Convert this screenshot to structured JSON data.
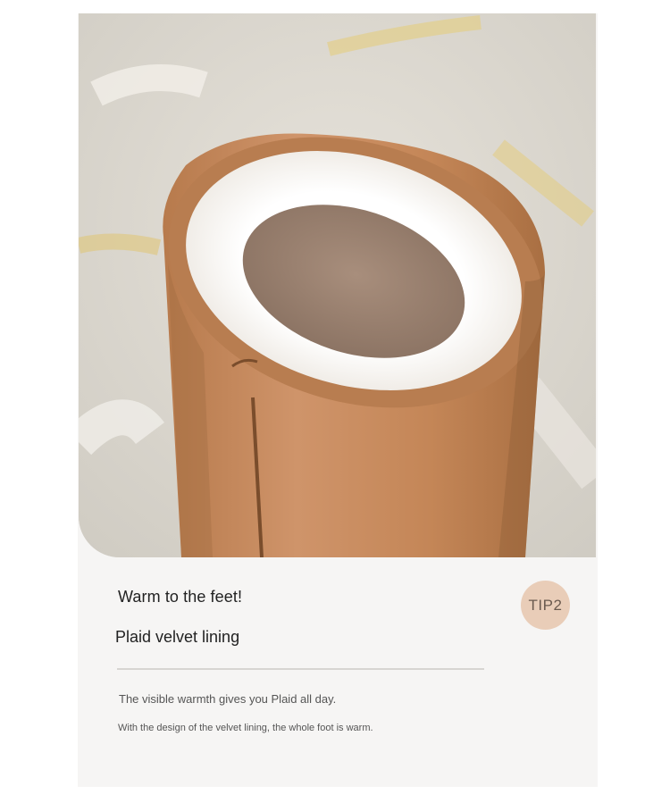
{
  "product_card": {
    "image_alt": "Suede boot with white plush velvet lining",
    "headline": "Warm to the feet!",
    "subhead": "Plaid velvet lining",
    "tip_badge": "TIP2",
    "description": "The visible warmth gives you Plaid all day.",
    "detail": "With the design of the velvet lining, the whole foot is warm."
  },
  "colors": {
    "card_background": "#f6f5f4",
    "badge_background": "#e9cdb8",
    "badge_text": "#6a5a4f",
    "boot_suede": "#c48a5c",
    "lining": "#fbf8f4"
  }
}
